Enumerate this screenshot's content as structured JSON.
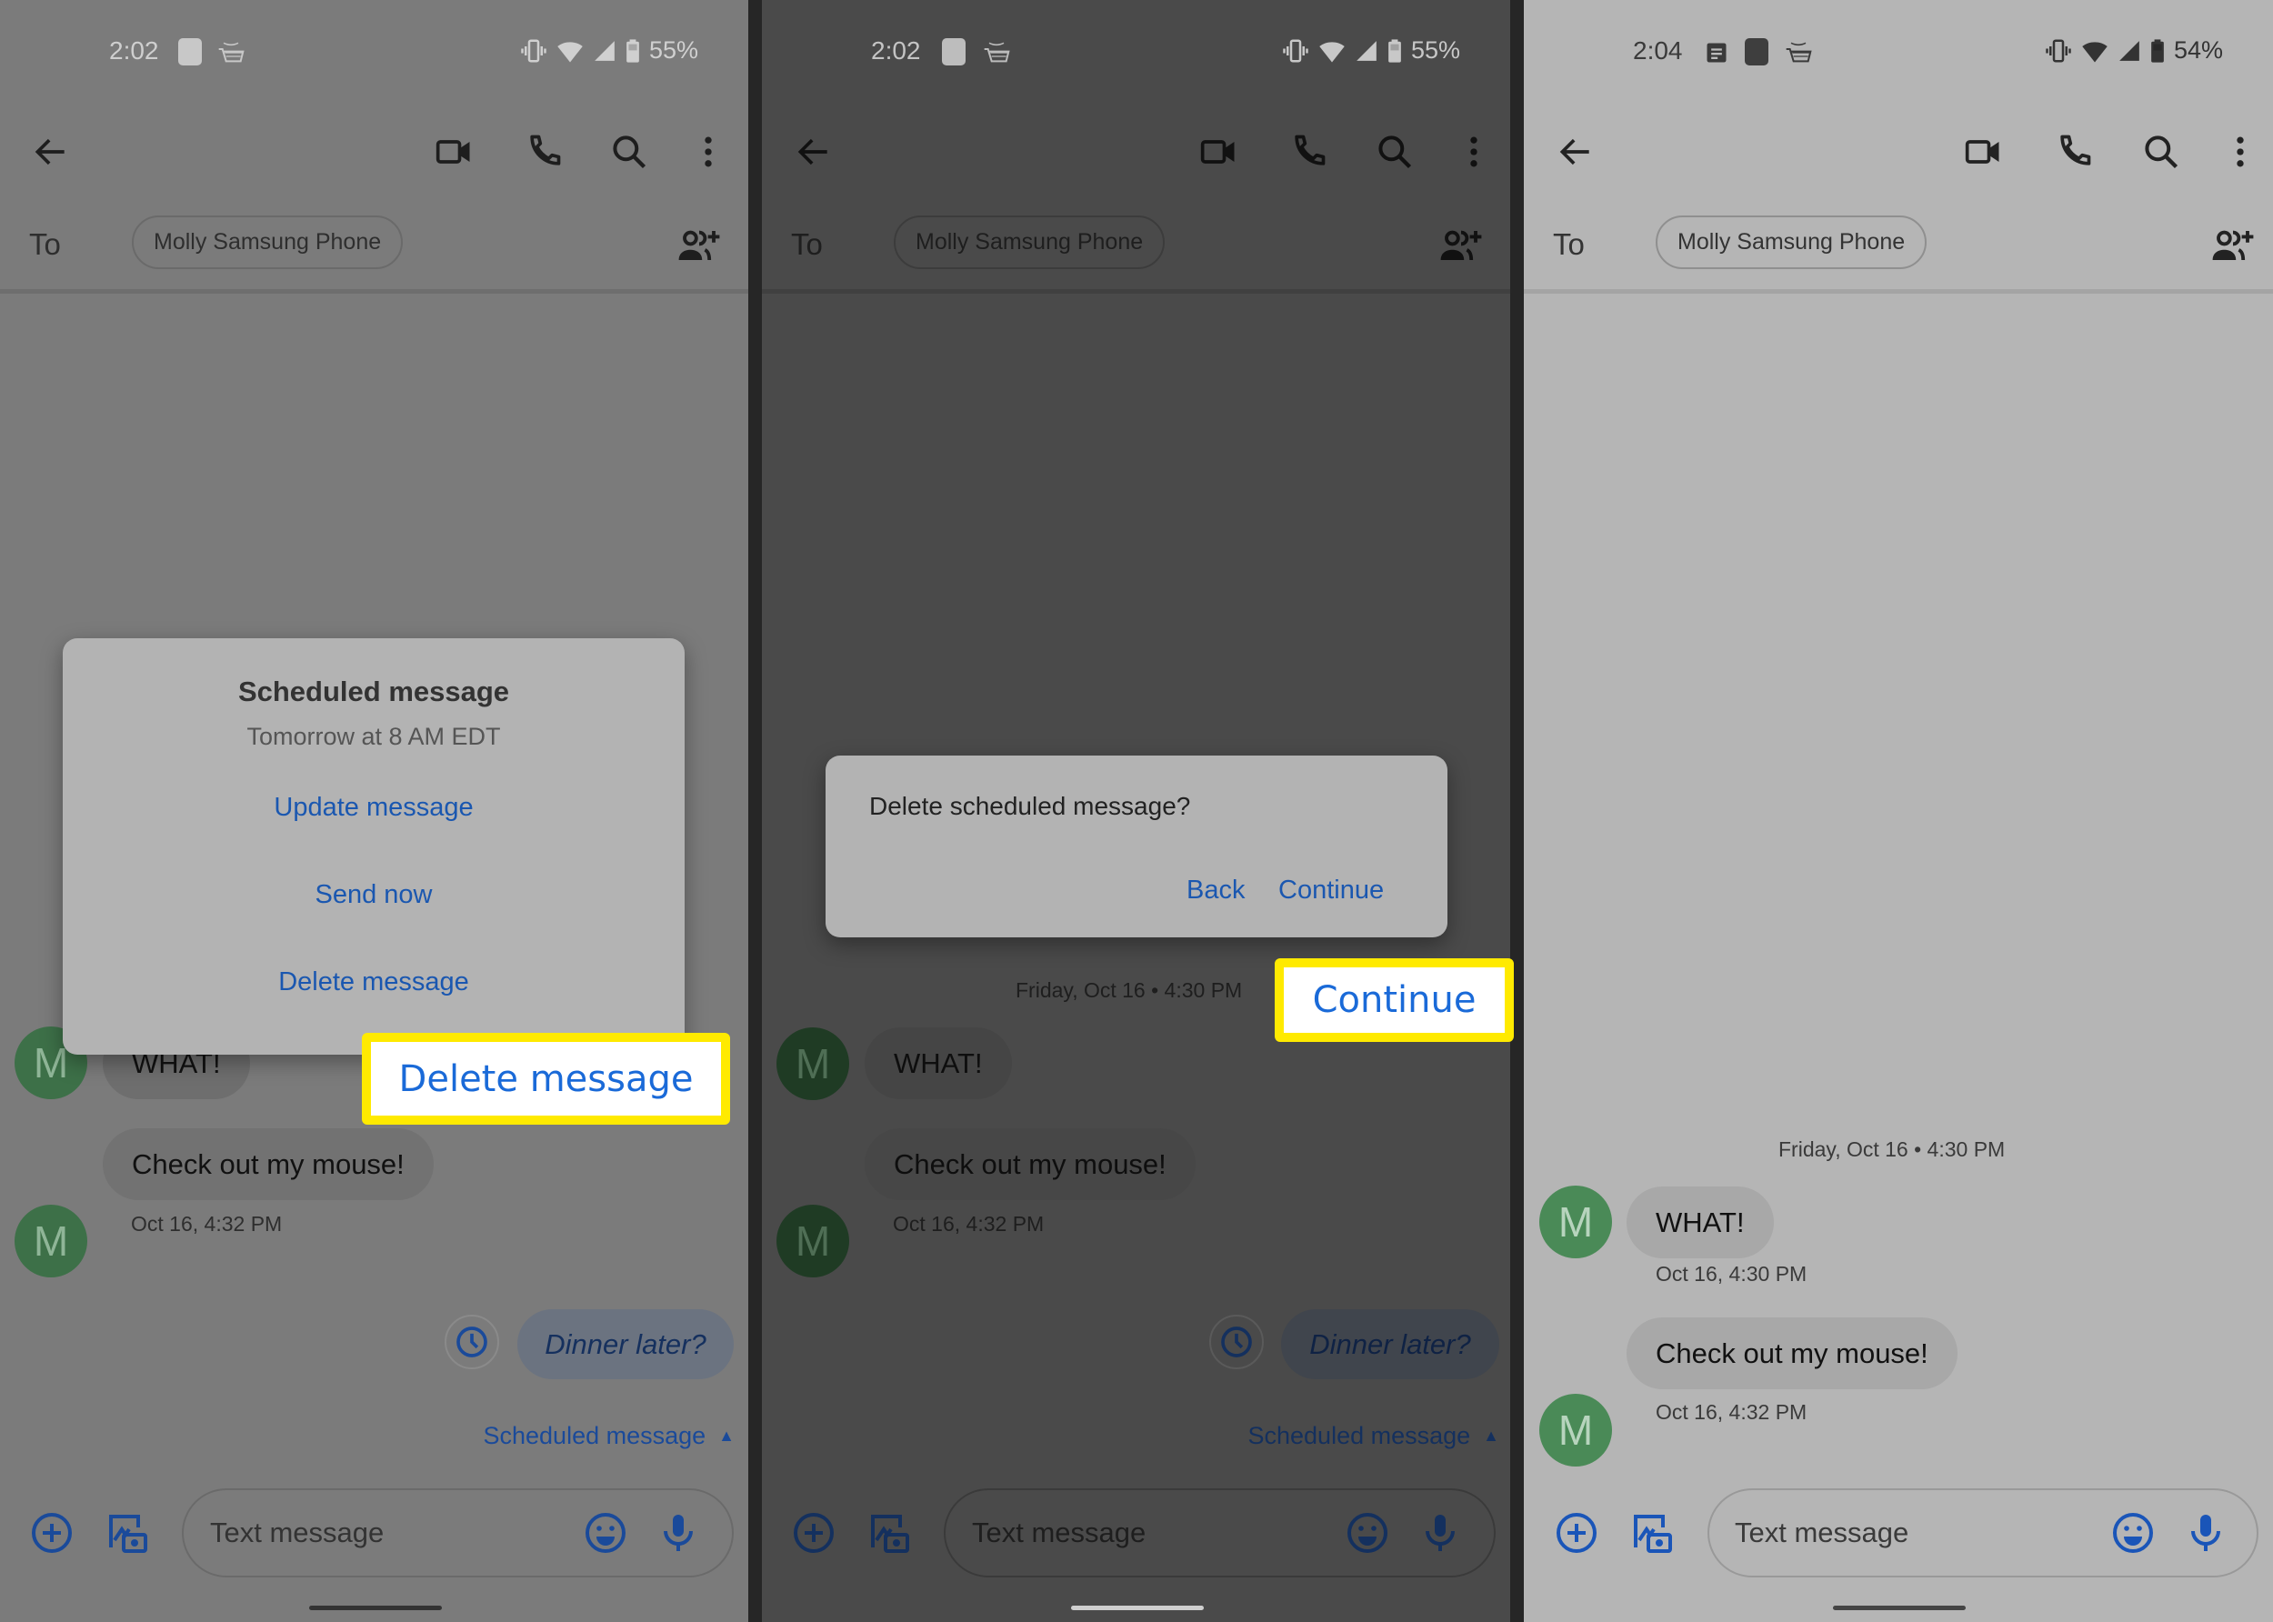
{
  "colors": {
    "highlight_border": "#ffea00",
    "highlight_text": "#1a6ad8",
    "link_blue": "#1a57b0",
    "avatar_green": "#3f8a4f"
  },
  "panels": [
    {
      "status_bar": {
        "time": "2:02",
        "battery": "55%",
        "icons": [
          "omron-connect-icon",
          "amazon-cart-icon",
          "vibrate-icon",
          "wifi-icon",
          "signal-icon",
          "battery-icon"
        ]
      },
      "toolbar": {
        "back": "back-arrow-icon",
        "actions": [
          "video-call-icon",
          "phone-icon",
          "search-icon",
          "more-vert-icon"
        ]
      },
      "recipient": {
        "to_label": "To",
        "chip": "Molly Samsung Phone"
      },
      "messages": [
        {
          "avatar": "M",
          "text": "WHAT!"
        },
        {
          "avatar": "M",
          "text": "Check out my mouse!",
          "timestamp": "Oct 16, 4:32 PM"
        }
      ],
      "scheduled": {
        "text": "Dinner later?",
        "label": "Scheduled message"
      },
      "composer": {
        "placeholder": "Text message"
      },
      "dialog": {
        "title": "Scheduled message",
        "subtitle": "Tomorrow at 8 AM EDT",
        "options": [
          "Update message",
          "Send now",
          "Delete message"
        ]
      },
      "callout": "Delete message"
    },
    {
      "status_bar": {
        "time": "2:02",
        "battery": "55%"
      },
      "recipient": {
        "to_label": "To",
        "chip": "Molly Samsung Phone"
      },
      "date_header": "Friday, Oct 16 • 4:30 PM",
      "messages": [
        {
          "avatar": "M",
          "text": "WHAT!"
        },
        {
          "avatar": "M",
          "text": "Check out my mouse!",
          "timestamp": "Oct 16, 4:32 PM"
        }
      ],
      "scheduled": {
        "text": "Dinner later?",
        "label": "Scheduled message"
      },
      "composer": {
        "placeholder": "Text message"
      },
      "dialog": {
        "message": "Delete scheduled message?",
        "back": "Back",
        "continue": "Continue"
      },
      "callout": "Continue"
    },
    {
      "status_bar": {
        "time": "2:04",
        "battery": "54%"
      },
      "recipient": {
        "to_label": "To",
        "chip": "Molly Samsung Phone"
      },
      "date_header": "Friday, Oct 16 • 4:30 PM",
      "messages": [
        {
          "avatar": "M",
          "text": "WHAT!",
          "timestamp": "Oct 16, 4:30 PM"
        },
        {
          "avatar": "M",
          "text": "Check out my mouse!",
          "timestamp": "Oct 16, 4:32 PM"
        }
      ],
      "composer": {
        "placeholder": "Text message"
      }
    }
  ]
}
